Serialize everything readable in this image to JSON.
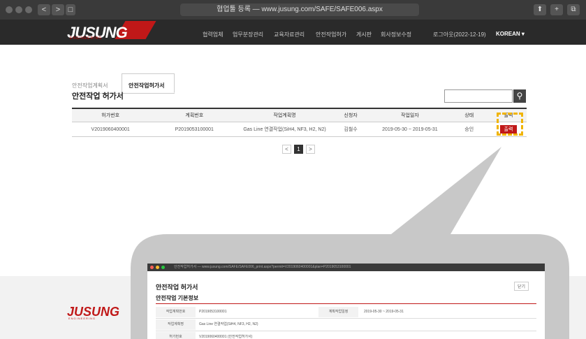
{
  "browser": {
    "address": "협업툴 등록 — www.jusung.com/SAFE/SAFE006.aspx",
    "nav_back": "<",
    "nav_forward": ">",
    "sidebar_toggle": "□"
  },
  "header": {
    "logo": "JUSUNG",
    "logo_sub": "ENGINEERING",
    "menu": [
      "협력업체",
      "업무분장관리",
      "교육자료관리",
      "안전작업허가",
      "게시판",
      "회사정보수정",
      "로그아웃(2022-12-19)"
    ],
    "user": "KOREAN ▾"
  },
  "tabs": [
    {
      "label": "안전작업계획서",
      "active": false
    },
    {
      "label": "안전작업허가서",
      "active": true
    }
  ],
  "page_title": "안전작업 허가서",
  "search": {
    "placeholder": "",
    "button_icon": "search-icon"
  },
  "table": {
    "headers": [
      "허가번호",
      "계획번호",
      "작업계획명",
      "신청자",
      "작업일자",
      "상태",
      "출력"
    ],
    "rows": [
      {
        "permit_no": "V2019060400001",
        "plan_no": "P2019053100001",
        "plan_name": "Gas Line 연결작업(SiH4, NF3, H2, N2)",
        "applicant": "김철수",
        "date": "2019-05-30 ~ 2019-05-31",
        "status": "승인",
        "action": "출력"
      }
    ]
  },
  "pagination": {
    "prev": "<",
    "current": "1",
    "next": ">"
  },
  "footer": {
    "logo": "JUSUNG",
    "logo_sub": "ENGINEERING"
  },
  "popup": {
    "url": "안전작업허가서 — www.jusung.com/SAFE/SAFE006_print.aspx?permit=V2019060400001&plan=P2019053100001",
    "title": "안전작업 허가서",
    "close": "닫기",
    "subtitle": "안전작업 기본정보",
    "fields": [
      {
        "label": "작업계획번호",
        "value": "P2019053100001",
        "label2": "계획작업일정",
        "value2": "2019-05-30 ~ 2019-05-31"
      },
      {
        "label": "작업계획명",
        "value": "Gas Line 연결작업(SiH4, NF3, H2, N2)"
      },
      {
        "label": "허가번호",
        "value": "V2019060400001 (안전작업허가서)"
      }
    ]
  },
  "colors": {
    "brand_red": "#c01818",
    "highlight": "#f0b400",
    "dark": "#2a2a2a"
  }
}
